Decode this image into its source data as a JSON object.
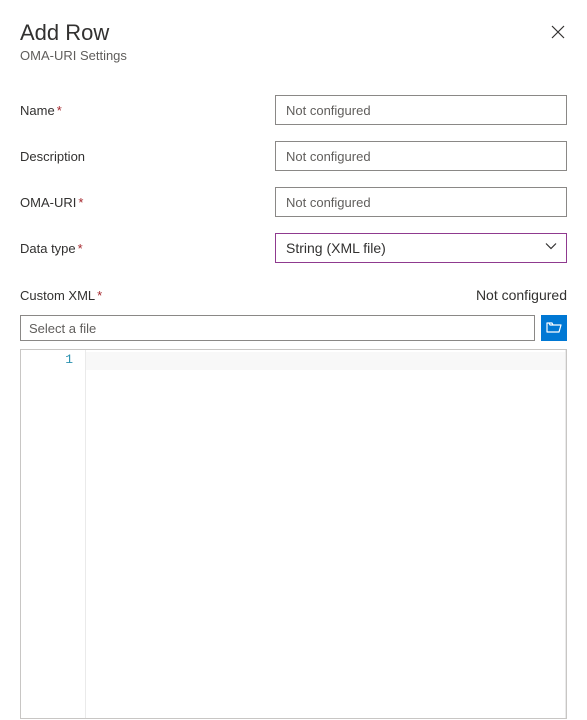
{
  "header": {
    "title": "Add Row",
    "subtitle": "OMA-URI Settings"
  },
  "fields": {
    "name": {
      "label": "Name",
      "required": "*",
      "placeholder": "Not configured",
      "value": ""
    },
    "description": {
      "label": "Description",
      "placeholder": "Not configured",
      "value": ""
    },
    "omauri": {
      "label": "OMA-URI",
      "required": "*",
      "placeholder": "Not configured",
      "value": ""
    },
    "datatype": {
      "label": "Data type",
      "required": "*",
      "value": "String (XML file)"
    }
  },
  "customxml": {
    "label": "Custom XML",
    "required": "*",
    "status": "Not configured",
    "file_placeholder": "Select a file"
  },
  "editor": {
    "line_number": "1"
  }
}
